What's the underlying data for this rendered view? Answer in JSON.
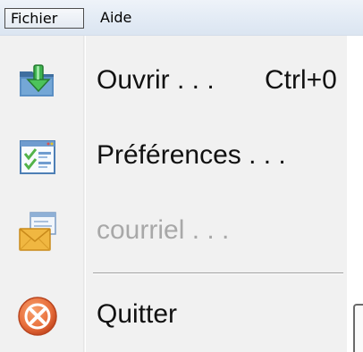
{
  "menubar": {
    "items": [
      {
        "label": "Fichier",
        "state": "open"
      },
      {
        "label": "Aide"
      }
    ]
  },
  "menu": {
    "items": [
      {
        "label": "Ouvrir . . .",
        "shortcut": "Ctrl+0",
        "icon": "open-folder-download-icon",
        "enabled": true
      },
      {
        "label": "Préférences . . .",
        "icon": "preferences-checklist-icon",
        "enabled": true
      },
      {
        "label": "courriel . . .",
        "icon": "email-envelope-icon",
        "enabled": false
      },
      {
        "separator": true
      },
      {
        "label": "Quitter",
        "icon": "quit-close-icon",
        "enabled": true
      }
    ]
  },
  "colors": {
    "menubar_bg": "#e3ebf5",
    "menu_bg": "#f1f1f1",
    "disabled_text": "#a8a8a8",
    "quit_icon": "#e86f3c"
  }
}
